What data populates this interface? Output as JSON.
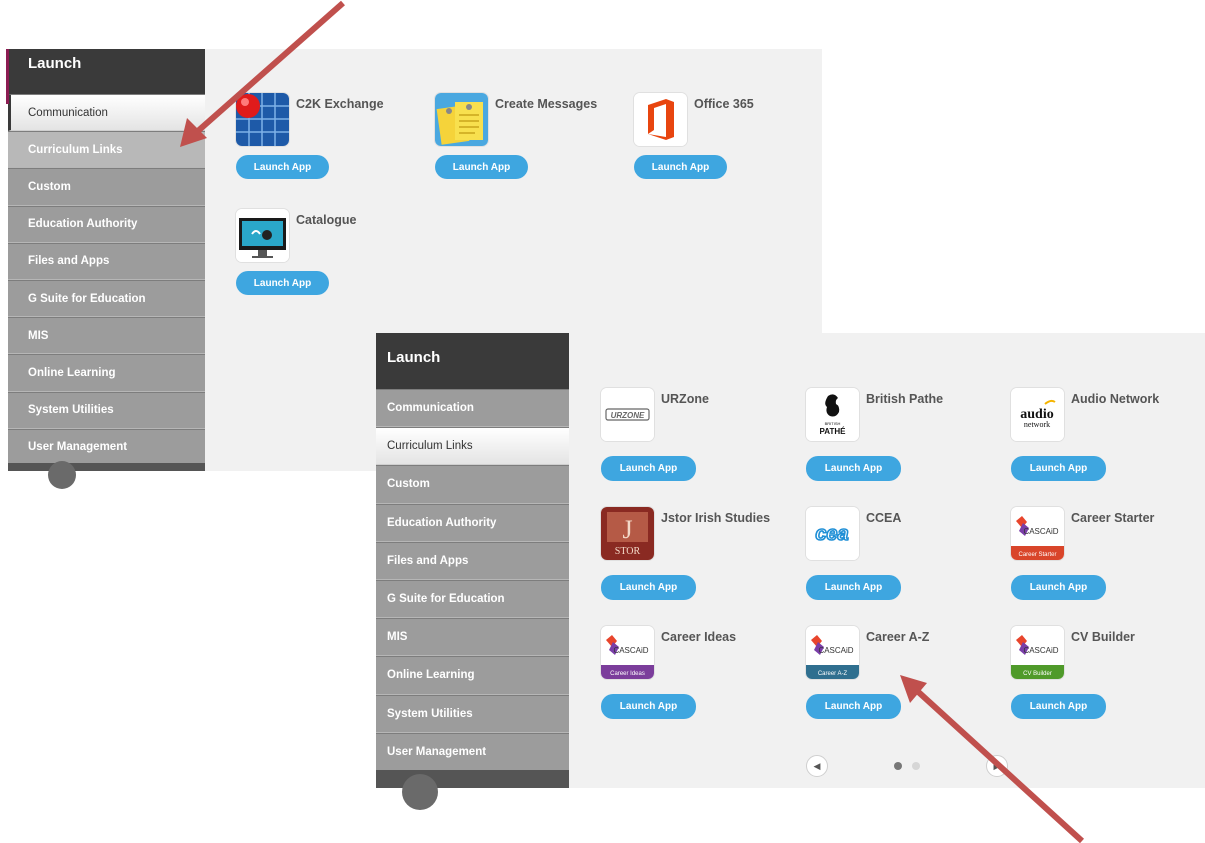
{
  "panel1": {
    "title": "Launch",
    "sidebar": [
      "Communication",
      "Curriculum Links",
      "Custom",
      "Education Authority",
      "Files and Apps",
      "G Suite for Education",
      "MIS",
      "Online Learning",
      "System Utilities",
      "User Management"
    ],
    "active_item": "Communication",
    "apps": [
      {
        "name": "C2K Exchange",
        "button": "Launch App",
        "icon": "c2k-exchange-icon"
      },
      {
        "name": "Create Messages",
        "button": "Launch App",
        "icon": "create-messages-icon"
      },
      {
        "name": "Office 365",
        "button": "Launch App",
        "icon": "office-365-icon"
      },
      {
        "name": "Catalogue",
        "button": "Launch App",
        "icon": "catalogue-icon"
      }
    ]
  },
  "panel2": {
    "title": "Launch",
    "sidebar": [
      "Communication",
      "Curriculum Links",
      "Custom",
      "Education Authority",
      "Files and Apps",
      "G Suite for Education",
      "MIS",
      "Online Learning",
      "System Utilities",
      "User Management"
    ],
    "active_item": "Curriculum Links",
    "apps": [
      {
        "name": "URZone",
        "button": "Launch App",
        "icon": "urzone-icon",
        "icon_text": "URZONE"
      },
      {
        "name": "British Pathe",
        "button": "Launch App",
        "icon": "british-pathe-icon",
        "icon_text": "PATHÉ",
        "icon_subtext": "BRITISH"
      },
      {
        "name": "Audio Network",
        "button": "Launch App",
        "icon": "audio-network-icon",
        "icon_text": "audio",
        "icon_subtext": "network"
      },
      {
        "name": "Jstor Irish Studies",
        "button": "Launch App",
        "icon": "jstor-icon",
        "icon_text": "STOR"
      },
      {
        "name": "CCEA",
        "button": "Launch App",
        "icon": "ccea-icon",
        "icon_text": "cea"
      },
      {
        "name": "Career Starter",
        "button": "Launch App",
        "icon": "career-starter-icon",
        "icon_text": "CASCAiD",
        "icon_subtext": "Career Starter"
      },
      {
        "name": "Career Ideas",
        "button": "Launch App",
        "icon": "career-ideas-icon",
        "icon_text": "CASCAiD",
        "icon_subtext": "Career Ideas"
      },
      {
        "name": "Career A-Z",
        "button": "Launch App",
        "icon": "career-az-icon",
        "icon_text": "CASCAiD",
        "icon_subtext": "Career A-Z"
      },
      {
        "name": "CV Builder",
        "button": "Launch App",
        "icon": "cv-builder-icon",
        "icon_text": "CASCAiD",
        "icon_subtext": "CV Builder"
      }
    ],
    "pager": {
      "prev": "◀",
      "next": "▶",
      "pages": 2,
      "current": 1
    }
  },
  "colors": {
    "accent": "#3ea6e0",
    "sidebar": "#9c9c9c",
    "header": "#3a3a3a",
    "arrow": "#c0504d"
  }
}
